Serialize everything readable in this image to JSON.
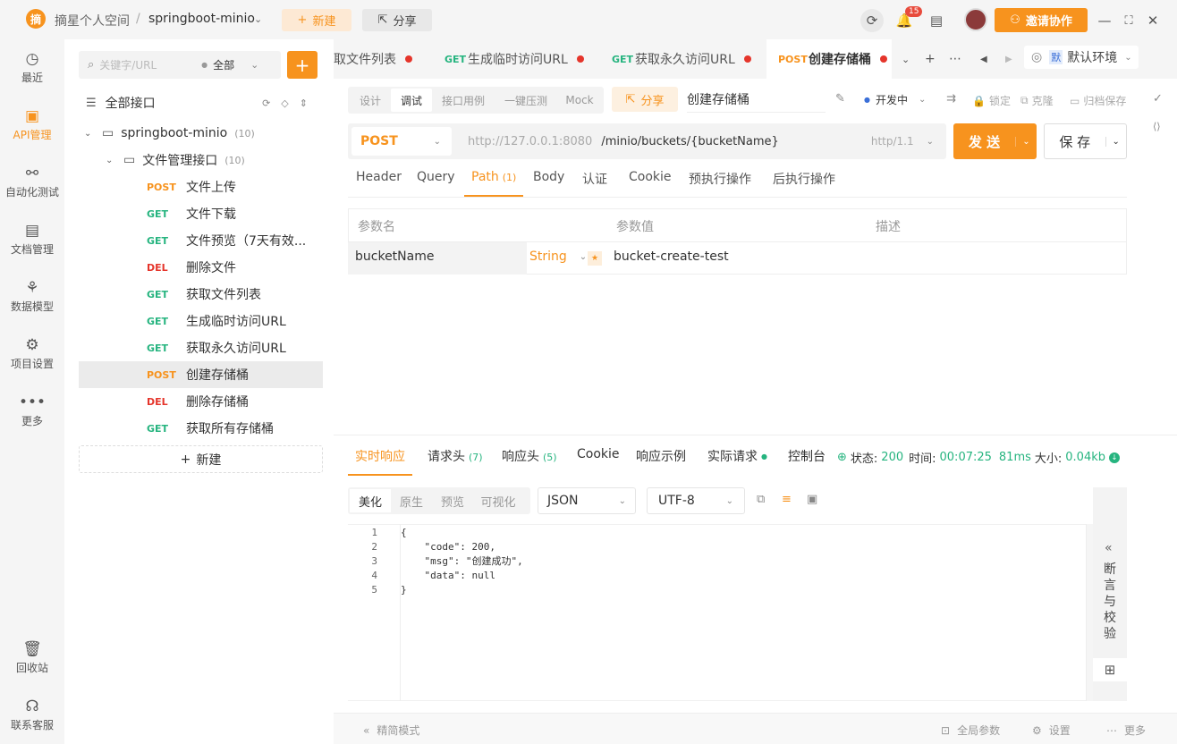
{
  "topbar": {
    "logo_text": "摘",
    "workspace": "摘星个人空间",
    "separator": "/",
    "project": "springboot-minio",
    "new_label": "新建",
    "share_label": "分享",
    "notification_count": "15",
    "invite_label": "邀请协作"
  },
  "leftnav": {
    "items": [
      {
        "label": "最近",
        "icon": "clock-icon",
        "glyph": "◷"
      },
      {
        "label": "API管理",
        "icon": "api-icon",
        "glyph": "▣"
      },
      {
        "label": "自动化测试",
        "icon": "automation-icon",
        "glyph": "⚯"
      },
      {
        "label": "文档管理",
        "icon": "document-icon",
        "glyph": "▤"
      },
      {
        "label": "数据模型",
        "icon": "data-model-icon",
        "glyph": "⚘"
      },
      {
        "label": "项目设置",
        "icon": "settings-icon",
        "glyph": "⚙"
      },
      {
        "label": "更多",
        "icon": "more-icon",
        "glyph": "•••"
      }
    ],
    "bottom": [
      {
        "label": "回收站",
        "icon": "trash-icon",
        "glyph": "🗑"
      },
      {
        "label": "联系客服",
        "icon": "headset-icon",
        "glyph": "☊"
      }
    ]
  },
  "tree": {
    "search_placeholder": "关键字/URL",
    "filter": "全部",
    "root_label": "全部接口",
    "project_label": "springboot-minio",
    "project_count": "(10)",
    "folder_label": "文件管理接口",
    "folder_count": "(10)",
    "items": [
      {
        "method": "POST",
        "name": "文件上传"
      },
      {
        "method": "GET",
        "name": "文件下载"
      },
      {
        "method": "GET",
        "name": "文件预览（7天有效..."
      },
      {
        "method": "DEL",
        "name": "删除文件"
      },
      {
        "method": "GET",
        "name": "获取文件列表"
      },
      {
        "method": "GET",
        "name": "生成临时访问URL"
      },
      {
        "method": "GET",
        "name": "获取永久访问URL"
      },
      {
        "method": "POST",
        "name": "创建存储桶"
      },
      {
        "method": "DEL",
        "name": "删除存储桶"
      },
      {
        "method": "GET",
        "name": "获取所有存储桶"
      }
    ],
    "new_label": "新建"
  },
  "tabs": [
    {
      "method": "",
      "label": "取文件列表"
    },
    {
      "method": "GET",
      "label": "生成临时访问URL"
    },
    {
      "method": "GET",
      "label": "获取永久访问URL"
    },
    {
      "method": "POST",
      "label": "创建存储桶"
    }
  ],
  "env": {
    "badge": "默",
    "label": "默认环境"
  },
  "subtabs": [
    "设计",
    "调试",
    "接口用例",
    "一键压测",
    "Mock"
  ],
  "share_label": "分享",
  "api_name": "创建存储桶",
  "status_label": "开发中",
  "actions": [
    "锁定",
    "克隆",
    "归档保存"
  ],
  "request": {
    "method": "POST",
    "host": "http://127.0.0.1:8080",
    "path": "/minio/buckets/{bucketName}",
    "protocol": "http/1.1",
    "send_label": "发 送",
    "save_label": "保 存"
  },
  "req_tabs": [
    "Header",
    "Query",
    "Path",
    "Body",
    "认证",
    "Cookie",
    "预执行操作",
    "后执行操作"
  ],
  "path_count": "(1)",
  "param_headers": [
    "参数名",
    "参数值",
    "描述"
  ],
  "param": {
    "name": "bucketName",
    "type": "String",
    "required": "★",
    "value": "bucket-create-test"
  },
  "resp_tabs": [
    {
      "label": "实时响应",
      "count": ""
    },
    {
      "label": "请求头",
      "count": "(7)"
    },
    {
      "label": "响应头",
      "count": "(5)"
    },
    {
      "label": "Cookie",
      "count": ""
    },
    {
      "label": "响应示例",
      "count": ""
    },
    {
      "label": "实际请求",
      "count": ""
    },
    {
      "label": "控制台",
      "count": ""
    }
  ],
  "resp_status": {
    "status_label": "状态:",
    "status": "200",
    "time_label": "时间:",
    "time": "00:07:25",
    "duration": "81ms",
    "size_label": "大小:",
    "size": "0.04kb"
  },
  "format_tabs": [
    "美化",
    "原生",
    "预览",
    "可视化"
  ],
  "format": "JSON",
  "encoding": "UTF-8",
  "code": [
    "{",
    "    \"code\": 200,",
    "    \"msg\": \"创建成功\",",
    "    \"data\": null",
    "}"
  ],
  "assert_panel": "断言与校验",
  "footer": {
    "simple_mode": "精简模式",
    "global_params": "全局参数",
    "settings": "设置",
    "more": "更多"
  },
  "colors": {
    "accent": "#f7931e",
    "get": "#26b47f",
    "del": "#e5352b",
    "success": "#26b47f"
  }
}
